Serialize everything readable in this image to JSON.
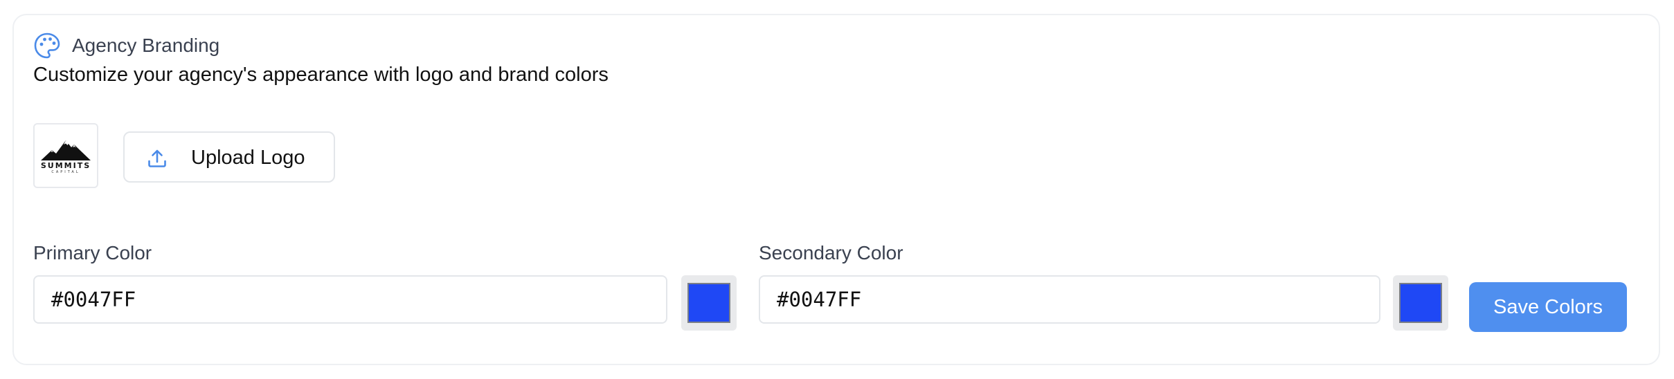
{
  "section": {
    "title": "Agency Branding",
    "subtitle": "Customize your agency's appearance with logo and brand colors",
    "icon": "palette-icon",
    "accent_color": "#4a8ae8"
  },
  "logo": {
    "wordmark": "SUMMITS",
    "tagline": "CAPITAL",
    "icon": "mountain-logo"
  },
  "upload": {
    "label": "Upload Logo",
    "icon": "upload-icon"
  },
  "primary_color": {
    "label": "Primary Color",
    "value": "#0047FF",
    "swatch": "#1f48f5"
  },
  "secondary_color": {
    "label": "Secondary Color",
    "value": "#0047FF",
    "swatch": "#1f48f5"
  },
  "save": {
    "label": "Save Colors",
    "color": "#4f8fef"
  }
}
